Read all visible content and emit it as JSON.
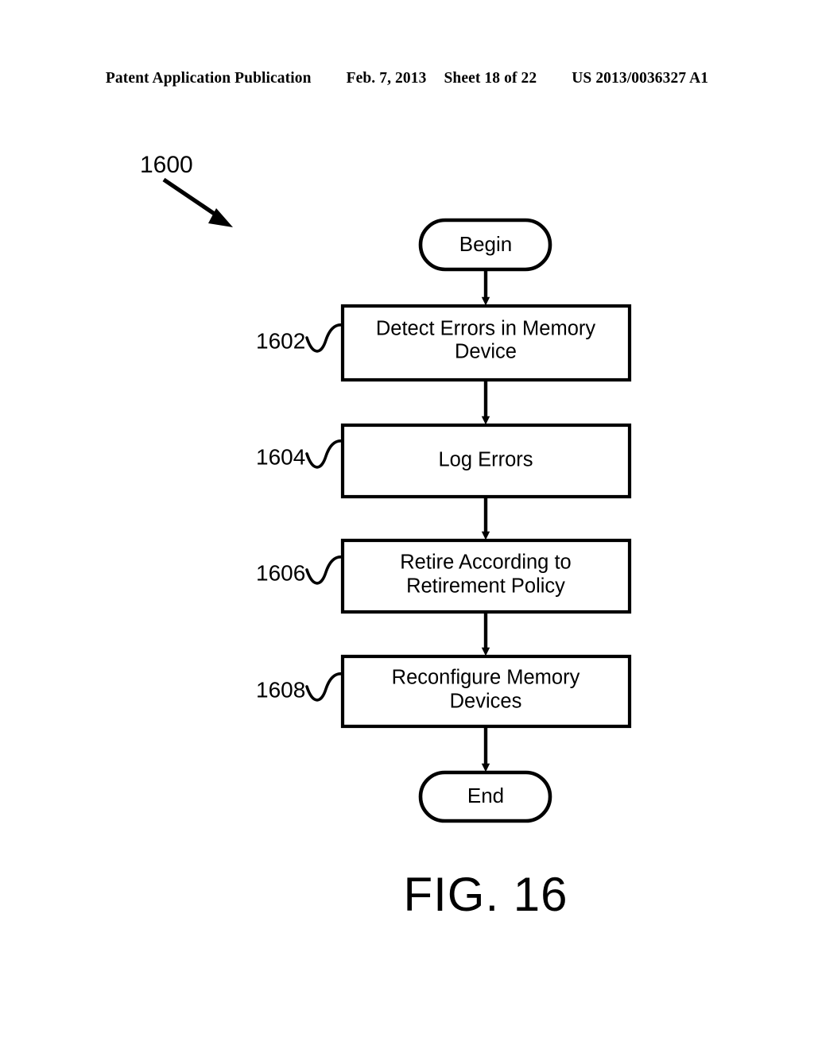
{
  "header": {
    "publication": "Patent Application Publication",
    "date": "Feb. 7, 2013",
    "sheet": "Sheet 18 of 22",
    "patent_number": "US 2013/0036327 A1"
  },
  "figure": {
    "caption": "FIG. 16",
    "diagram_reference": "1600"
  },
  "flowchart": {
    "type": "flowchart",
    "orientation": "vertical",
    "start_label": "Begin",
    "end_label": "End",
    "steps": [
      {
        "ref": "1602",
        "line1": "Detect Errors in Memory",
        "line2": "Device"
      },
      {
        "ref": "1604",
        "line1": "Log Errors",
        "line2": ""
      },
      {
        "ref": "1606",
        "line1": "Retire According to",
        "line2": "Retirement Policy"
      },
      {
        "ref": "1608",
        "line1": "Reconfigure Memory",
        "line2": "Devices"
      }
    ]
  },
  "colors": {
    "ink": "#000000",
    "paper": "#ffffff"
  }
}
